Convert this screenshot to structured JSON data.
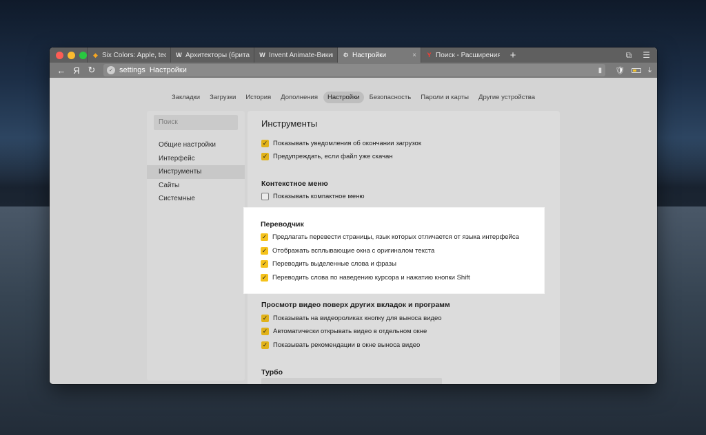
{
  "window": {
    "tabs": [
      {
        "title": "Six Colors: Apple, technology",
        "favicon": "sixcolors-icon",
        "active": false
      },
      {
        "title": "Архитекторы (британская",
        "favicon": "wikipedia-icon",
        "active": false
      },
      {
        "title": "Invent Animate-Википедия",
        "favicon": "wikipedia-icon",
        "active": false
      },
      {
        "title": "Настройки",
        "favicon": "gear-icon",
        "active": true
      },
      {
        "title": "Поиск - Расширения для",
        "favicon": "yandex-icon",
        "active": false
      }
    ],
    "new_tab": "+",
    "address": {
      "host": "settings",
      "title": "Настройки"
    },
    "toolbar": {
      "back": "←",
      "yandex_logo": "Я",
      "reload": "↻"
    }
  },
  "settings": {
    "nav": [
      "Закладки",
      "Загрузки",
      "История",
      "Дополнения",
      "Настройки",
      "Безопасность",
      "Пароли и карты",
      "Другие устройства"
    ],
    "nav_active": "Настройки",
    "search_placeholder": "Поиск",
    "sidebar": [
      "Общие настройки",
      "Интерфейс",
      "Инструменты",
      "Сайты",
      "Системные"
    ],
    "sidebar_active": "Инструменты",
    "panel_title": "Инструменты",
    "downloads": {
      "options": [
        {
          "label": "Показывать уведомления об окончании загрузок",
          "checked": true
        },
        {
          "label": "Предупреждать, если файл уже скачан",
          "checked": true
        }
      ]
    },
    "context_menu": {
      "title": "Контекстное меню",
      "options": [
        {
          "label": "Показывать компактное меню",
          "checked": false
        }
      ]
    },
    "translator": {
      "title": "Переводчик",
      "options": [
        {
          "label": "Предлагать перевести страницы, язык которых отличается от языка интерфейса",
          "checked": true
        },
        {
          "label": "Отображать всплывающие окна с оригиналом текста",
          "checked": true
        },
        {
          "label": "Переводить выделенные слова и фразы",
          "checked": true
        },
        {
          "label": "Переводить слова по наведению курсора и нажатию кнопки Shift",
          "checked": true
        }
      ]
    },
    "video": {
      "title": "Просмотр видео поверх других вкладок и программ",
      "options": [
        {
          "label": "Показывать на видеороликах кнопку для выноса видео",
          "checked": true
        },
        {
          "label": "Автоматически открывать видео в отдельном окне",
          "checked": true
        },
        {
          "label": "Показывать рекомендации в окне выноса видео",
          "checked": true
        }
      ]
    },
    "turbo": {
      "title": "Турбо"
    }
  },
  "colors": {
    "accent": "#f5c21b"
  }
}
